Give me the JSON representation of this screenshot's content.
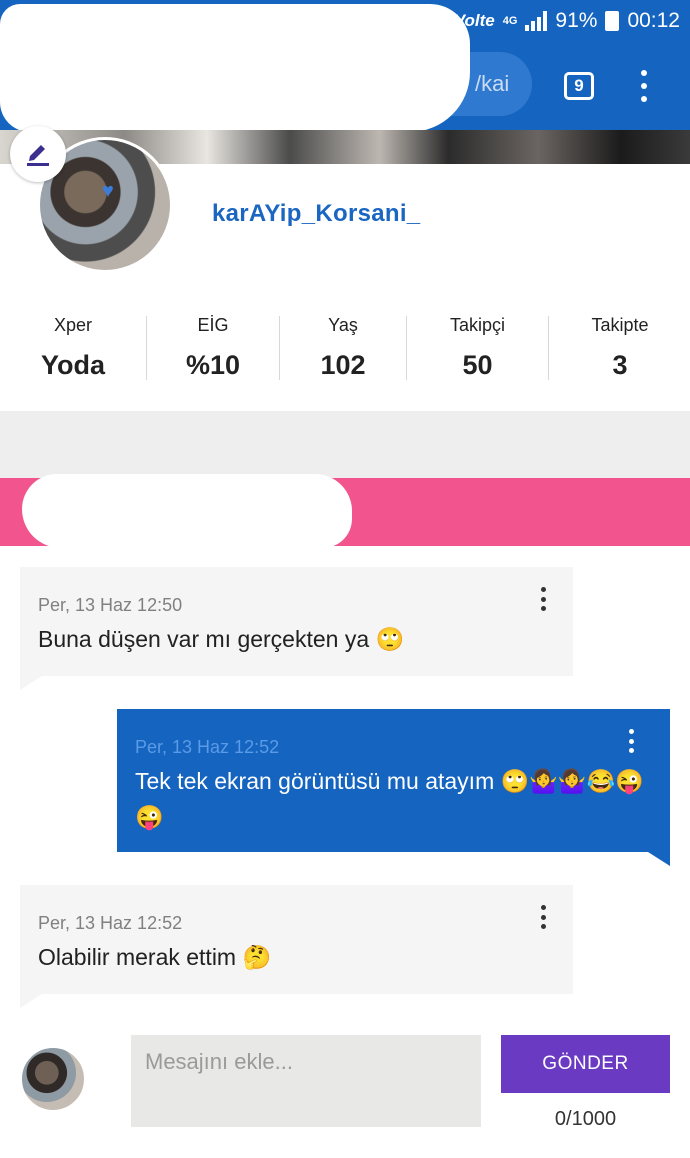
{
  "status_bar": {
    "network": "Volte",
    "data_type": "4G",
    "battery": "91%",
    "time": "00:12"
  },
  "browser": {
    "url_fragment": "/kai",
    "tab_count": "9"
  },
  "profile": {
    "username": "karAYip_Korsani_",
    "stats": [
      {
        "label": "Xper",
        "value": "Yoda"
      },
      {
        "label": "EİG",
        "value": "%10"
      },
      {
        "label": "Yaş",
        "value": "102"
      },
      {
        "label": "Takipçi",
        "value": "50"
      },
      {
        "label": "Takipte",
        "value": "3"
      }
    ]
  },
  "messages": [
    {
      "direction": "in",
      "time": "Per, 13 Haz 12:50",
      "text": "Buna düşen var mı gerçekten ya 🙄"
    },
    {
      "direction": "out",
      "time": "Per, 13 Haz 12:52",
      "text": "Tek tek ekran görüntüsü mu atayım 🙄🤷‍♀️🤷‍♀️😂😜😜"
    },
    {
      "direction": "in",
      "time": "Per, 13 Haz 12:52",
      "text": "Olabilir merak ettim 🤔"
    }
  ],
  "composer": {
    "placeholder": "Mesajını ekle...",
    "send_label": "GÖNDER",
    "counter": "0/1000"
  },
  "colors": {
    "primary_blue": "#1565c0",
    "pink_band": "#f2548e",
    "send_purple": "#6a3ac2"
  }
}
